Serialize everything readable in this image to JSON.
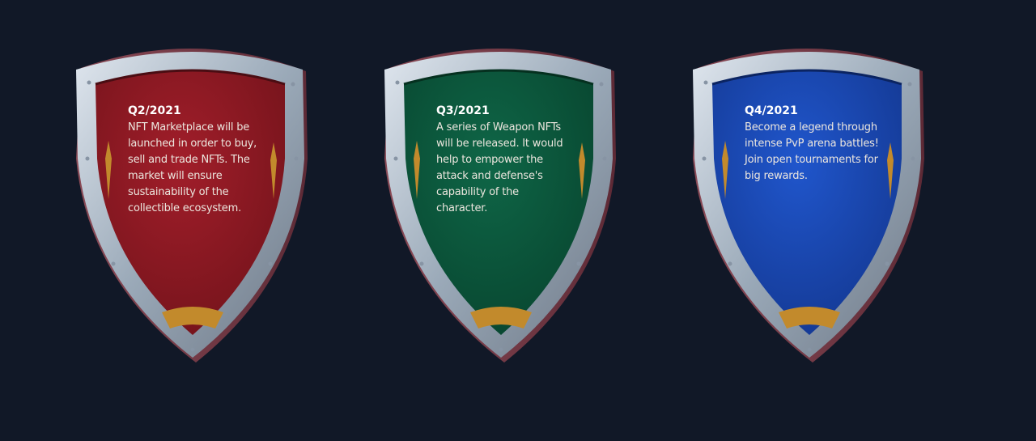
{
  "roadmap": {
    "items": [
      {
        "quarter": "Q2/2021",
        "description": "NFT Marketplace will be launched in order to buy, sell and trade NFTs. The market will ensure sustainability of the collectible ecosystem.",
        "color": "#8f1a24",
        "icon": "red-shield-icon"
      },
      {
        "quarter": "Q3/2021",
        "description": "A series of Weapon NFTs will be released. It would help to empower the attack and defense's capability of the character.",
        "color": "#0c5a3e",
        "icon": "green-shield-icon"
      },
      {
        "quarter": "Q4/2021",
        "description": "Become a legend through intense PvP arena battles! Join open tournaments for big rewards.",
        "color": "#1b4bbd",
        "icon": "blue-shield-icon"
      }
    ]
  }
}
